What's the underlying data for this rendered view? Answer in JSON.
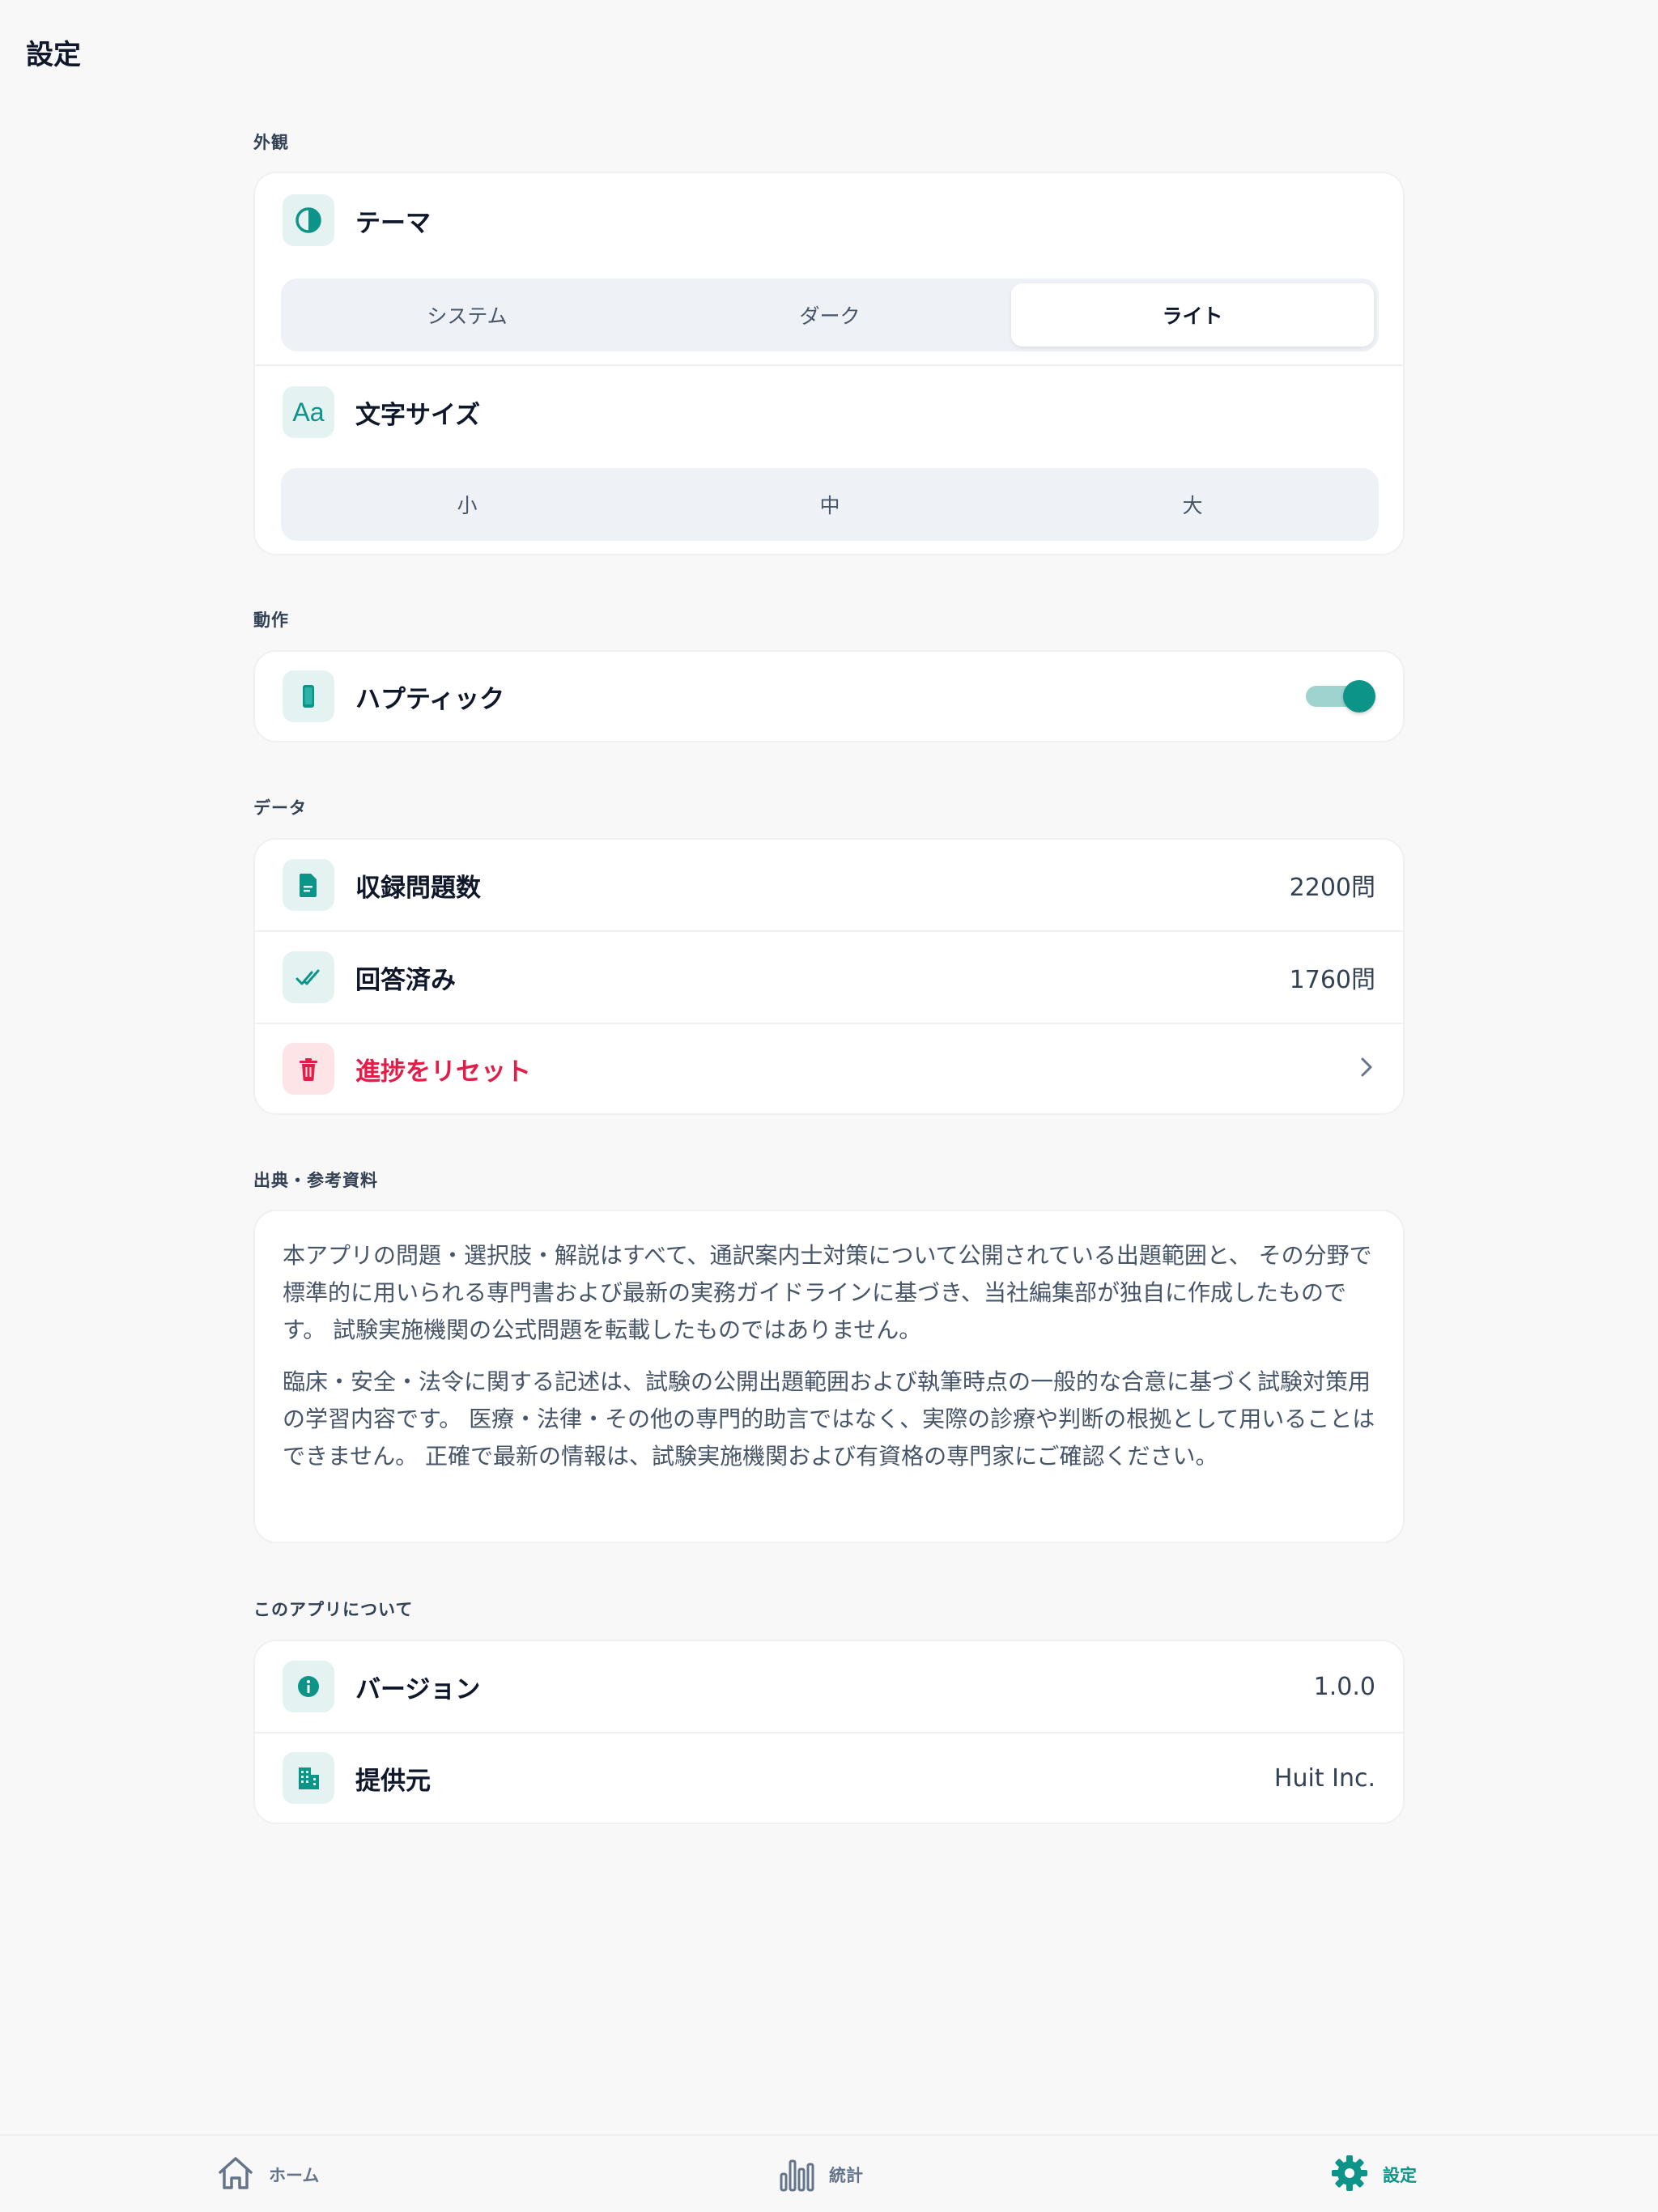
{
  "header": {
    "title": "設定"
  },
  "appearance": {
    "section_label": "外観",
    "theme": {
      "label": "テーマ",
      "icon": "contrast-icon",
      "options": [
        "システム",
        "ダーク",
        "ライト"
      ],
      "selected": "ライト"
    },
    "font_size": {
      "label": "文字サイズ",
      "icon": "text-size-icon",
      "icon_text": "Aa",
      "options": [
        "小",
        "中",
        "大"
      ],
      "selected": null
    }
  },
  "behavior": {
    "section_label": "動作",
    "haptics": {
      "label": "ハプティック",
      "icon": "phone-icon",
      "enabled": true
    }
  },
  "data_section": {
    "section_label": "データ",
    "total_questions": {
      "label": "収録問題数",
      "value": "2200問",
      "icon": "document-icon"
    },
    "answered": {
      "label": "回答済み",
      "value": "1760問",
      "icon": "double-check-icon"
    },
    "reset": {
      "label": "進捗をリセット",
      "icon": "trash-icon"
    }
  },
  "sources": {
    "section_label": "出典・参考資料",
    "paragraph1": "本アプリの問題・選択肢・解説はすべて、通訳案内士対策について公開されている出題範囲と、 その分野で標準的に用いられる専門書および最新の実務ガイドラインに基づき、当社編集部が独自に作成したものです。 試験実施機関の公式問題を転載したものではありません。",
    "paragraph2": "臨床・安全・法令に関する記述は、試験の公開出題範囲および執筆時点の一般的な合意に基づく試験対策用の学習内容です。 医療・法律・その他の専門的助言ではなく、実際の診療や判断の根拠として用いることはできません。 正確で最新の情報は、試験実施機関および有資格の専門家にご確認ください。"
  },
  "about": {
    "section_label": "このアプリについて",
    "version": {
      "label": "バージョン",
      "value": "1.0.0",
      "icon": "info-icon"
    },
    "provider": {
      "label": "提供元",
      "value": "Huit Inc.",
      "icon": "building-icon"
    }
  },
  "tabbar": {
    "items": [
      {
        "label": "ホーム",
        "icon": "home-icon",
        "active": false
      },
      {
        "label": "統計",
        "icon": "bar-chart-icon",
        "active": false
      },
      {
        "label": "設定",
        "icon": "gear-icon",
        "active": true
      }
    ]
  },
  "colors": {
    "accent": "#0d9488",
    "danger": "#e11d48",
    "background": "#f8f8f8",
    "card": "#ffffff"
  }
}
